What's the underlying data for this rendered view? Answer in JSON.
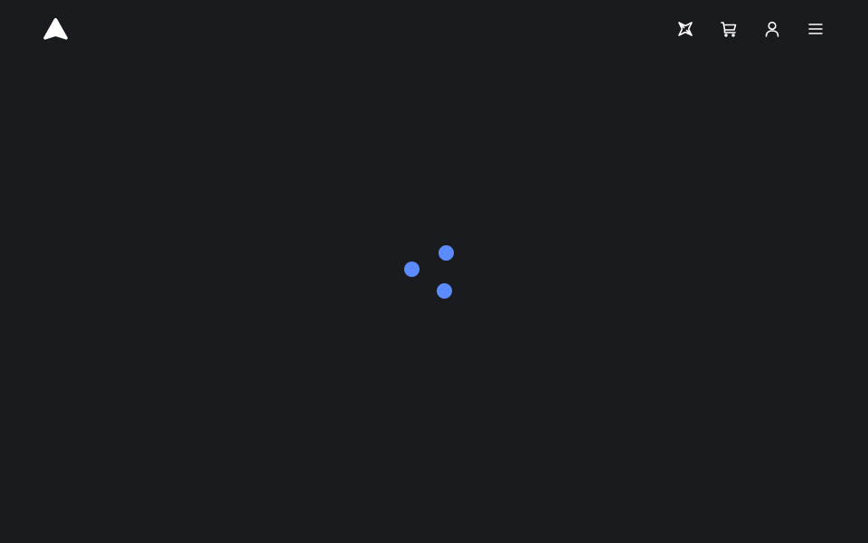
{
  "header": {
    "logo": {
      "icon": "logo-arrow-icon"
    },
    "nav": [
      {
        "name": "explore-button",
        "icon": "expand-arrows-icon"
      },
      {
        "name": "cart-button",
        "icon": "cart-icon"
      },
      {
        "name": "account-button",
        "icon": "user-icon"
      },
      {
        "name": "menu-button",
        "icon": "hamburger-icon"
      }
    ]
  },
  "loader": {
    "state": "loading",
    "dot_count": 3
  },
  "colors": {
    "background": "#1a1b1e",
    "icon": "#ffffff",
    "accent": "#5b8cff"
  }
}
